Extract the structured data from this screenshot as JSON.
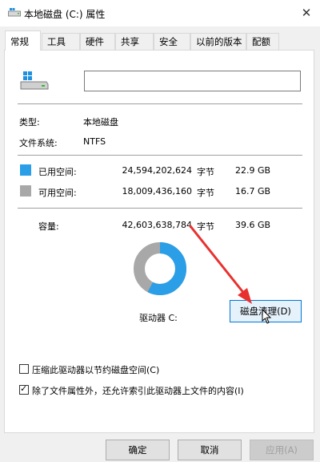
{
  "window": {
    "title": "本地磁盘 (C:) 属性",
    "close_glyph": "✕"
  },
  "tabs": [
    {
      "label": "常规",
      "active": true
    },
    {
      "label": "工具"
    },
    {
      "label": "硬件"
    },
    {
      "label": "共享"
    },
    {
      "label": "安全"
    },
    {
      "label": "以前的版本"
    },
    {
      "label": "配额"
    }
  ],
  "drive": {
    "name_value": ""
  },
  "info": {
    "type_label": "类型:",
    "type_value": "本地磁盘",
    "fs_label": "文件系统:",
    "fs_value": "NTFS"
  },
  "space": {
    "used": {
      "label": "已用空间:",
      "bytes": "24,594,202,624",
      "unit": "字节",
      "size": "22.9 GB",
      "color": "#2a9ee6"
    },
    "free": {
      "label": "可用空间:",
      "bytes": "18,009,436,160",
      "unit": "字节",
      "size": "16.7 GB",
      "color": "#a8a8a8"
    },
    "capacity": {
      "label": "容量:",
      "bytes": "42,603,638,784",
      "unit": "字节",
      "size": "39.6 GB"
    },
    "used_fraction": 0.577
  },
  "drive_label": "驱动器 C:",
  "cleanup_button": "磁盘清理(D)",
  "options": {
    "compress": {
      "label": "压缩此驱动器以节约磁盘空间(C)",
      "checked": false
    },
    "index": {
      "label": "除了文件属性外，还允许索引此驱动器上文件的内容(I)",
      "checked": true
    }
  },
  "buttons": {
    "ok": "确定",
    "cancel": "取消",
    "apply": "应用(A)"
  },
  "icons": {
    "title": "drive-icon",
    "close": "close-icon",
    "drive": "drive-icon",
    "check": "checkmark-icon",
    "cursor": "mouse-cursor-icon",
    "arrow": "annotation-arrow"
  }
}
